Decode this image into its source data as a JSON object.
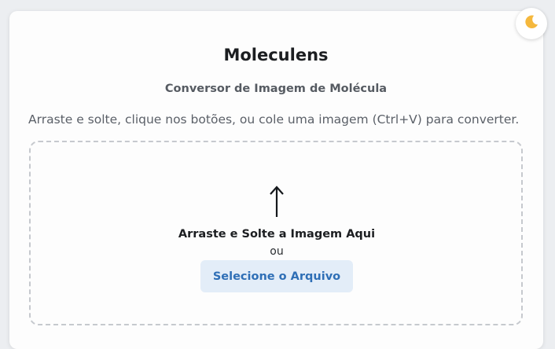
{
  "app": {
    "title": "Moleculens",
    "subtitle": "Conversor de Imagem de Molécula",
    "instructions": "Arraste e solte, clique nos botões, ou cole uma imagem (Ctrl+V) para converter."
  },
  "theme_toggle": {
    "icon": "moon-icon"
  },
  "dropzone": {
    "icon": "upload-arrow-icon",
    "drop_label": "Arraste e Solte a Imagem Aqui",
    "or_label": "ou",
    "select_button_label": "Selecione o Arquivo"
  },
  "colors": {
    "accent": "#2f6fb6",
    "button_bg": "#e3edf8",
    "moon": "#f5b83d"
  }
}
